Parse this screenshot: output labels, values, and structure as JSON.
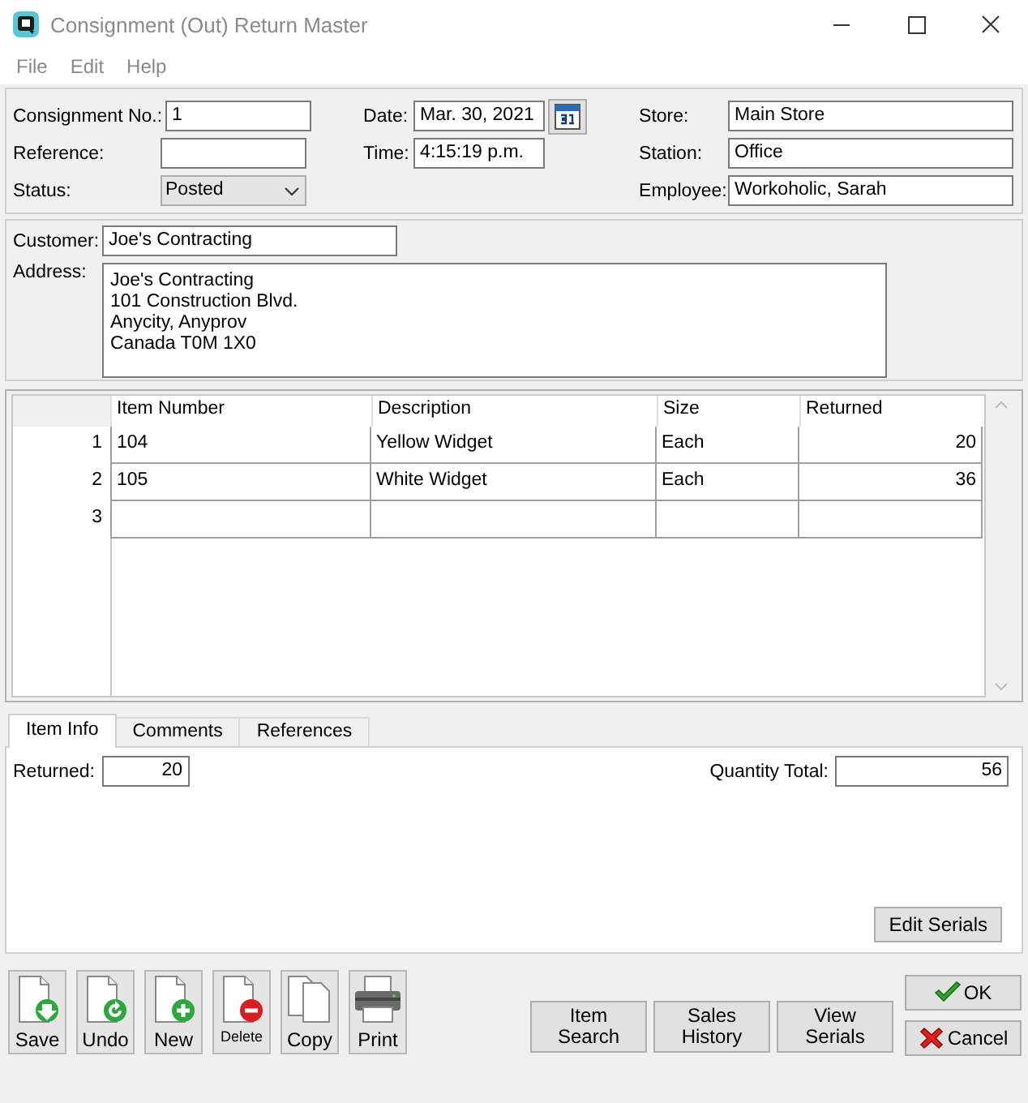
{
  "window": {
    "title": "Consignment (Out) Return Master"
  },
  "menu": [
    "File",
    "Edit",
    "Help"
  ],
  "header": {
    "columns": [
      [
        {
          "label": "Consignment No.:",
          "value": "1",
          "kind": "text"
        },
        {
          "label": "Reference:",
          "kind": "text"
        },
        {
          "label": "Status:",
          "value": "Posted",
          "kind": "dropdown"
        }
      ],
      [
        {
          "label": "Date:",
          "value": "Mar. 30, 2021",
          "kind": "date"
        },
        {
          "label": "Time:",
          "value": "4:15:19 p.m.",
          "kind": "text"
        }
      ],
      [
        {
          "label": "Store:",
          "value": "Main Store",
          "kind": "text"
        },
        {
          "label": "Station:",
          "value": "Office",
          "kind": "text"
        },
        {
          "label": "Employee:",
          "value": "Workoholic, Sarah",
          "kind": "text"
        }
      ]
    ]
  },
  "customer": {
    "label": "Customer:",
    "value": "Joe's Contracting"
  },
  "address": {
    "label": "Address:",
    "lines": [
      "Joe's Contracting",
      "101 Construction Blvd.",
      "Anycity, Anyprov",
      "Canada  T0M 1X0"
    ]
  },
  "table": {
    "columns": [
      {
        "label": "Item Number"
      },
      {
        "label": "Description"
      },
      {
        "label": "Size"
      },
      {
        "label": "Returned"
      }
    ],
    "rows": [
      {
        "number": "1",
        "cells": [
          "104",
          "Yellow Widget",
          "Each",
          "20"
        ]
      },
      {
        "number": "2",
        "cells": [
          "105",
          "White Widget",
          "Each",
          "36"
        ]
      },
      {
        "number": "3",
        "cells": []
      }
    ]
  },
  "tabs": [
    {
      "label": "Item Info",
      "selected": true
    },
    {
      "label": "Comments",
      "selected": false
    },
    {
      "label": "References",
      "selected": false
    }
  ],
  "item_info": {
    "returned": {
      "label": "Returned:",
      "value": "20"
    },
    "quantity_total": {
      "label": "Quantity Total:",
      "value": "56"
    },
    "edit_serials": "Edit Serials"
  },
  "toolbar": [
    {
      "label": "Save",
      "kind": "save"
    },
    {
      "label": "Undo",
      "kind": "undo"
    },
    {
      "label": "New",
      "kind": "new"
    },
    {
      "label": "Delete",
      "kind": "delete"
    },
    {
      "label": "Copy",
      "kind": "copy"
    },
    {
      "label": "Print",
      "kind": "print"
    }
  ],
  "actions": [
    "Item Search",
    "Sales History",
    "View Serials"
  ],
  "dialog_buttons": [
    {
      "label": "OK",
      "kind": "ok"
    },
    {
      "label": "Cancel",
      "kind": "cancel"
    }
  ]
}
